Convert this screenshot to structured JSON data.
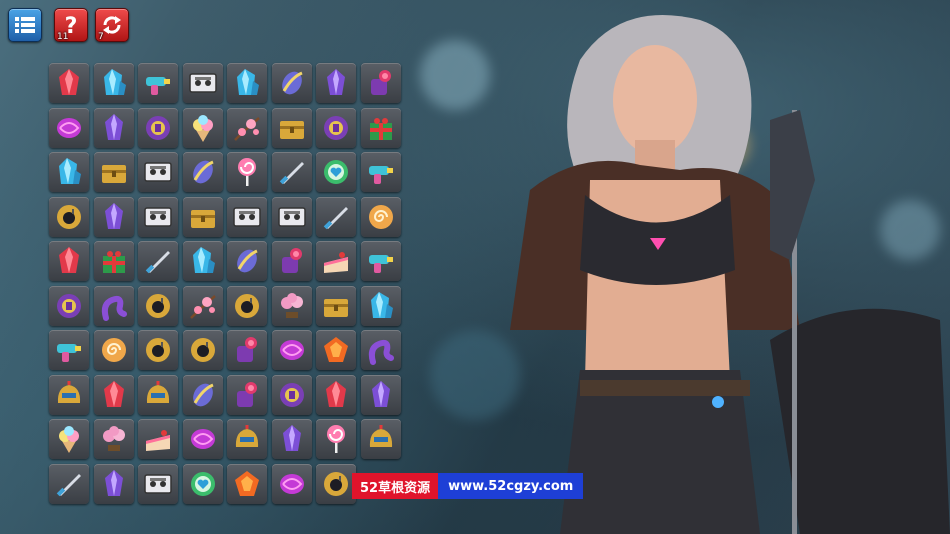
{
  "toolbar": {
    "menu_icon": "menu-list-icon",
    "hint_icon": "question-icon",
    "hint_count": "11",
    "shuffle_icon": "shuffle-arrows-icon",
    "shuffle_count": "7",
    "colors": {
      "menu": "#2f7fd0",
      "hint": "#d42020",
      "shuffle": "#d42020"
    }
  },
  "board": {
    "rows": [
      [
        "red-crystal",
        "blue-crystal",
        "ray-gun",
        "cassette",
        "blue-crystal",
        "feather-token",
        "purple-crystal",
        "rose-bag"
      ],
      [
        "pink-candy",
        "purple-crystal",
        "purple-coin",
        "ice-cream",
        "sakura-branch",
        "gold-chest",
        "purple-coin",
        "gift-box"
      ],
      [
        "blue-crystal",
        "gold-chest",
        "cassette",
        "feather-token",
        "lollipop",
        "dagger",
        "heart-coin",
        "ray-gun"
      ],
      [
        "bomb-coin",
        "purple-crystal",
        "cassette",
        "gold-chest",
        "cassette",
        "cassette",
        "dagger",
        "swirl-cookie"
      ],
      [
        "red-crystal",
        "gift-box",
        "dagger",
        "blue-crystal",
        "feather-token",
        "rose-bag",
        "cake-slice",
        "ray-gun"
      ],
      [
        "purple-coin",
        "tentacle",
        "bomb-coin",
        "sakura-branch",
        "bomb-coin",
        "bonsai",
        "gold-chest",
        "blue-crystal"
      ],
      [
        "ray-gun",
        "swirl-cookie",
        "bomb-coin",
        "bomb-coin",
        "rose-bag",
        "pink-candy",
        "orange-gem",
        "tentacle"
      ],
      [
        "gold-helmet",
        "red-crystal",
        "gold-helmet",
        "feather-token",
        "rose-bag",
        "purple-coin",
        "red-crystal",
        "purple-crystal"
      ],
      [
        "ice-cream",
        "bonsai",
        "cake-slice",
        "pink-candy",
        "gold-helmet",
        "purple-crystal",
        "lollipop",
        "gold-helmet"
      ],
      [
        "dagger",
        "purple-crystal",
        "cassette",
        "heart-coin",
        "orange-gem",
        "pink-candy",
        "bomb-coin",
        ""
      ]
    ]
  },
  "watermark": {
    "left_text": "52草根资源",
    "right_text": "www.52cgzy.com"
  }
}
